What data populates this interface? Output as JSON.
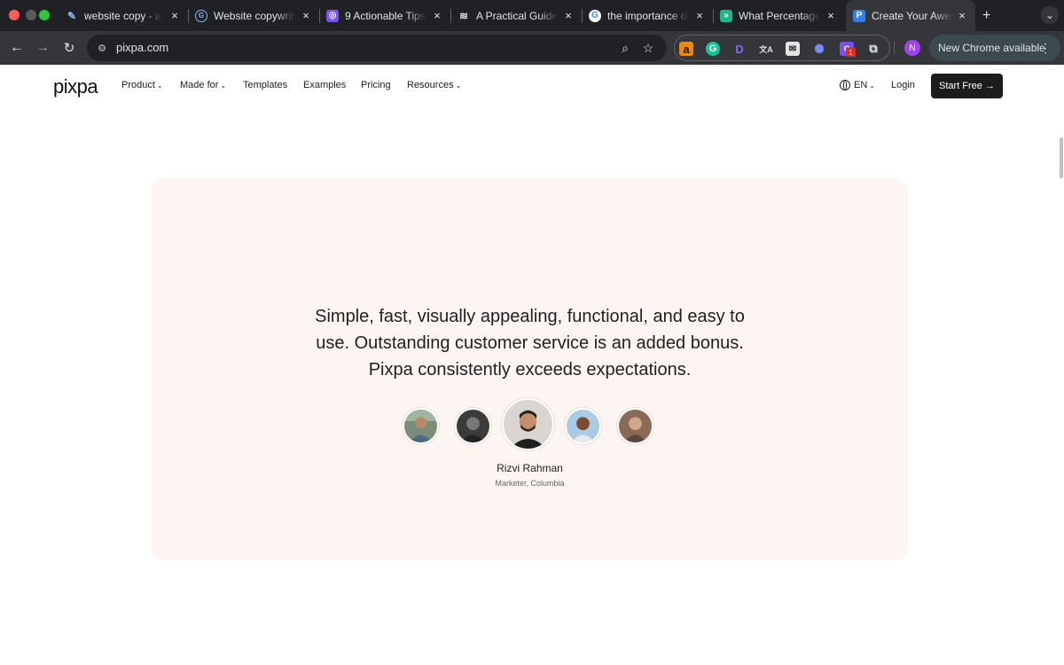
{
  "browser": {
    "tabs": [
      {
        "title": "website copy - ana",
        "favicon": "feather-icon",
        "favicon_color": "#8ab4f8"
      },
      {
        "title": "Website copywritin",
        "favicon": "g-swirl-icon",
        "favicon_color": "#4285f4"
      },
      {
        "title": "9 Actionable Tips",
        "favicon": "ghost-icon",
        "favicon_color": "#7c4dff"
      },
      {
        "title": "A Practical Guide t",
        "favicon": "layers-icon",
        "favicon_color": "#e3e3e3"
      },
      {
        "title": "the importance of",
        "favicon": "google-icon",
        "favicon_color": "#ffffff"
      },
      {
        "title": "What Percentage o",
        "favicon": "double-arrow-icon",
        "favicon_color": "#1fb58f"
      },
      {
        "title": "Create Your Aweso",
        "favicon": "pixpa-p-icon",
        "favicon_color": "#2f80ed",
        "active": true
      }
    ],
    "close_glyph": "×",
    "new_tab_glyph": "+",
    "tab_search_glyph": "⌄",
    "url": "pixpa.com",
    "extensions": [
      "amazon-icon",
      "grammarly-icon",
      "d-icon",
      "translate-icon",
      "mail-icon",
      "puzzle-gear-icon",
      "extension-badge-icon"
    ],
    "extension_badge_count": "1",
    "profile_initial": "N",
    "update_label": "New Chrome available",
    "menu_glyph": "⋮"
  },
  "site": {
    "logo": "pixpa",
    "nav": [
      {
        "label": "Product",
        "dropdown": true
      },
      {
        "label": "Made for",
        "dropdown": true
      },
      {
        "label": "Templates",
        "dropdown": false
      },
      {
        "label": "Examples",
        "dropdown": false
      },
      {
        "label": "Pricing",
        "dropdown": false
      },
      {
        "label": "Resources",
        "dropdown": true
      }
    ],
    "language": "EN",
    "login": "Login",
    "cta": "Start Free →"
  },
  "testimonial": {
    "quote_lines": [
      "Simple, fast, visually appealing, functional, and easy to",
      "use. Outstanding customer service is an added bonus.",
      "Pixpa consistently exceeds expectations."
    ],
    "name": "Rizvi Rahman",
    "role": "Marketer, Columbia",
    "avatar_count": 5,
    "selected_avatar": 3,
    "card_color": "#fdf5f1"
  },
  "colors": {
    "tab_strip": "#202124",
    "toolbar": "#35363a",
    "cta_bg": "#1c1c1c"
  }
}
